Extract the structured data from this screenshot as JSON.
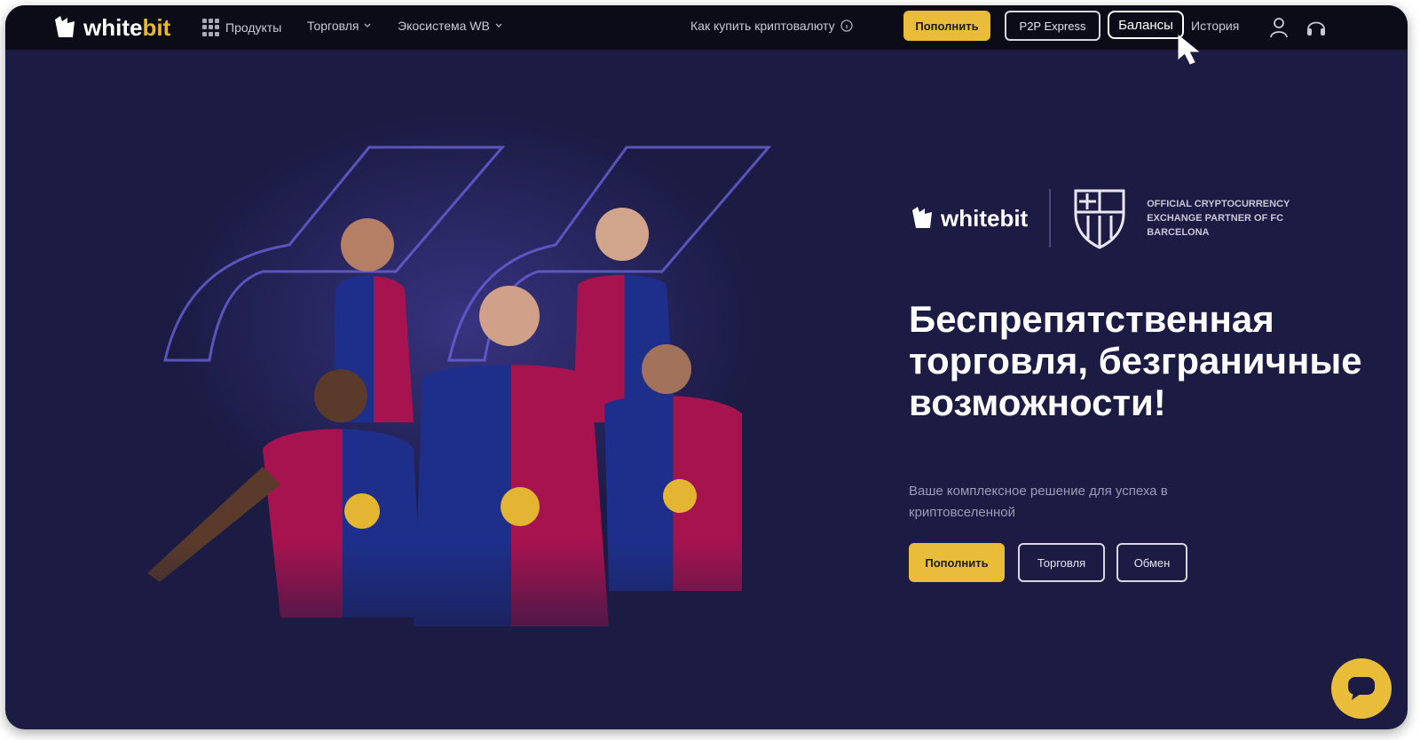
{
  "header": {
    "logo": {
      "part1": "white",
      "part2": "bit",
      "icon": "whitebit-logo-icon"
    },
    "nav": [
      {
        "label": "Продукты",
        "icon": "grid-icon"
      },
      {
        "label": "Торговля",
        "icon": "chevron-down-icon"
      },
      {
        "label": "Экосистема WB",
        "icon": "chevron-down-icon"
      }
    ],
    "how_to_buy": {
      "label": "Как купить криптовалюту",
      "icon": "info-icon"
    },
    "deposit_label": "Пополнить",
    "p2p_label": "P2P Express",
    "balances_label": "Балансы",
    "history_label": "История",
    "icons": [
      "user-icon",
      "headset-icon"
    ]
  },
  "hero": {
    "partner": {
      "brand_part1": "white",
      "brand_part2": "bit",
      "text": "OFFICIAL CRYPTOCURRENCY EXCHANGE PARTNER OF FC BARCELONA",
      "crest": "fc-barcelona-crest-icon"
    },
    "headline": "Беспрепятственная торговля, безграничные возможности!",
    "subtitle": "Ваше комплексное решение для успеха в криптовселенной",
    "buttons": {
      "deposit": "Пополнить",
      "trade": "Торговля",
      "exchange": "Обмен"
    },
    "image": "fc-barcelona-players-image"
  },
  "chat": {
    "icon": "chat-icon"
  },
  "colors": {
    "accent": "#e9bd3a",
    "background": "#1b1b44",
    "topbar": "#0c0c18"
  }
}
